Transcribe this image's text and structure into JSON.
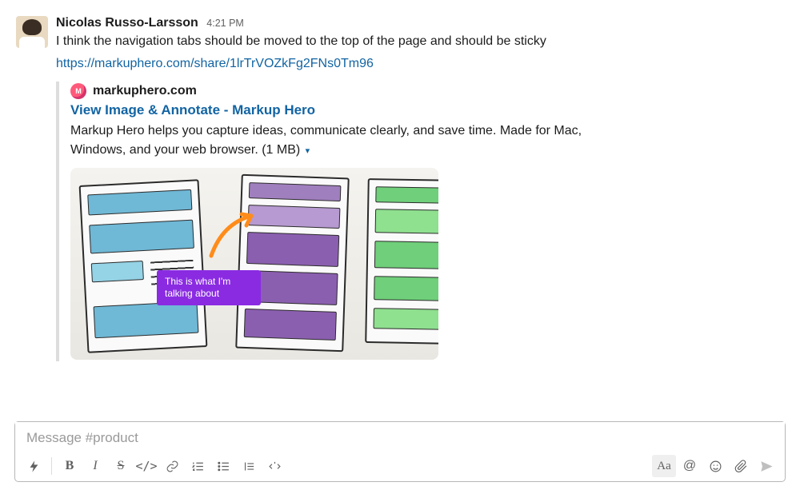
{
  "message": {
    "author": "Nicolas Russo-Larsson",
    "timestamp": "4:21 PM",
    "text": "I think the navigation tabs should be moved to the top of the page and should be sticky",
    "link": "https://markuphero.com/share/1lrTrVOZkFg2FNs0Tm96",
    "attachment": {
      "site_icon_label": "M",
      "site_name": "markuphero.com",
      "title": "View Image & Annotate - Markup Hero",
      "description": "Markup Hero helps you capture ideas, communicate clearly, and save time. Made for Mac, Windows, and your web browser. (1 MB)",
      "caret": "▾",
      "annotation_text": "This is what I'm talking about"
    }
  },
  "composer": {
    "placeholder": "Message #product",
    "buttons": {
      "lightning": "⚡",
      "bold": "B",
      "italic": "I",
      "strike": "S",
      "code": "</>",
      "aa": "Aa",
      "mention": "@",
      "emoji": "☺"
    }
  }
}
